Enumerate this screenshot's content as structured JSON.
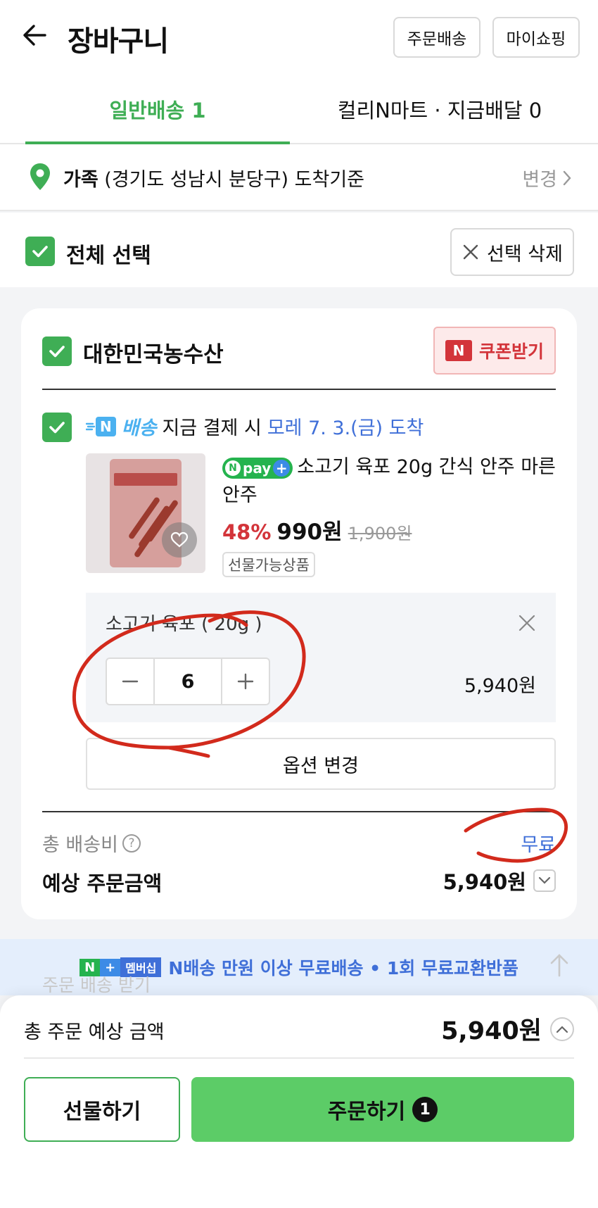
{
  "header": {
    "title": "장바구니",
    "order_delivery_label": "주문배송",
    "my_shopping_label": "마이쇼핑"
  },
  "tabs": [
    {
      "label": "일반배송 1",
      "active": true
    },
    {
      "label": "컬리N마트 · 지금배달 0",
      "active": false
    }
  ],
  "address": {
    "name": "가족",
    "detail": "(경기도 성남시 분당구) 도착기준",
    "change_label": "변경"
  },
  "select_all": {
    "label": "전체 선택",
    "checked": true,
    "delete_label": "선택 삭제"
  },
  "store": {
    "name": "대한민국농수산",
    "checked": true,
    "coupon_badge": "N",
    "coupon_label": "쿠폰받기"
  },
  "item": {
    "checked": true,
    "ship_badge": "N",
    "ship_label": "배송",
    "ship_text": "지금 결제 시",
    "ship_eta": "모레 7. 3.(금) 도착",
    "npay_n": "N",
    "npay_label": "pay",
    "npay_plus": "+",
    "name": "소고기 육포 20g 간식 안주 마른안주",
    "discount": "48%",
    "price": "990원",
    "original_price": "1,900원",
    "tag": "선물가능상품",
    "option": {
      "name": "소고기 육포 ( 20g )",
      "quantity": "6",
      "price": "5,940원"
    },
    "change_option_label": "옵션 변경"
  },
  "summary": {
    "shipping_label": "총 배송비",
    "shipping_value": "무료",
    "estimate_label": "예상 주문금액",
    "estimate_value": "5,940원"
  },
  "banner": {
    "badge_a": "N",
    "badge_b": "+",
    "badge_c": "멤버십",
    "text": "N배송 만원 이상 무료배송 • 1회 무료교환반품",
    "faded_text": "주문 배송 받기"
  },
  "bottom": {
    "total_label": "총 주문 예상 금액",
    "total_value": "5,940원",
    "gift_label": "선물하기",
    "order_label": "주문하기",
    "order_count": "1"
  },
  "colors": {
    "accent_green": "#3fae55",
    "order_button": "#5ccc67",
    "discount_red": "#d3343a",
    "link_blue": "#3f6fd8",
    "annotation_red": "#d22a1c"
  }
}
